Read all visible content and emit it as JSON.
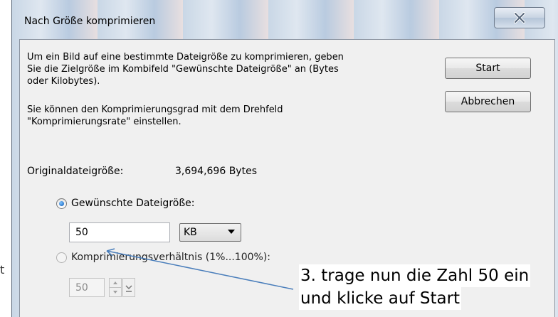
{
  "window": {
    "title": "Nach Größe komprimieren",
    "close_label": "X"
  },
  "description": {
    "line1": "Um ein Bild auf eine bestimmte Dateigröße zu komprimieren, geben",
    "line2": "Sie die Zielgröße im Kombifeld \"Gewünschte Dateigröße\" an (Bytes",
    "line3": "oder Kilobytes).",
    "line4": "Sie können den Komprimierungsgrad mit dem Drehfeld",
    "line5": "\"Komprimierungsrate\" einstellen."
  },
  "buttons": {
    "start": "Start",
    "cancel": "Abbrechen"
  },
  "original_size": {
    "label": "Originaldateigröße:",
    "value": "3,694,696 Bytes"
  },
  "desired_size": {
    "label": "Gewünschte Dateigröße:",
    "selected": true,
    "value": "50",
    "unit": "KB"
  },
  "compression_ratio": {
    "label": "Komprimierungsverhältnis (1%...100%):",
    "selected": false,
    "value": "50"
  },
  "annotation": {
    "line1": "3. trage nun die Zahl 50 ein",
    "line2": "und klicke auf Start",
    "arrow_color": "#4a7ebb"
  },
  "edge_mark": "t"
}
